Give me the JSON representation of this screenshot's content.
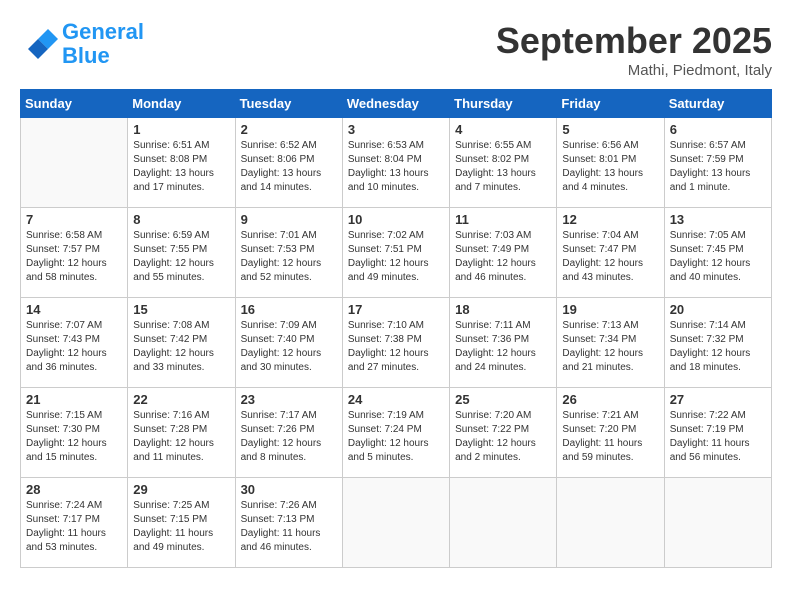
{
  "header": {
    "logo_line1": "General",
    "logo_line2": "Blue",
    "month": "September 2025",
    "location": "Mathi, Piedmont, Italy"
  },
  "weekdays": [
    "Sunday",
    "Monday",
    "Tuesday",
    "Wednesday",
    "Thursday",
    "Friday",
    "Saturday"
  ],
  "weeks": [
    [
      {
        "day": "",
        "info": ""
      },
      {
        "day": "1",
        "info": "Sunrise: 6:51 AM\nSunset: 8:08 PM\nDaylight: 13 hours\nand 17 minutes."
      },
      {
        "day": "2",
        "info": "Sunrise: 6:52 AM\nSunset: 8:06 PM\nDaylight: 13 hours\nand 14 minutes."
      },
      {
        "day": "3",
        "info": "Sunrise: 6:53 AM\nSunset: 8:04 PM\nDaylight: 13 hours\nand 10 minutes."
      },
      {
        "day": "4",
        "info": "Sunrise: 6:55 AM\nSunset: 8:02 PM\nDaylight: 13 hours\nand 7 minutes."
      },
      {
        "day": "5",
        "info": "Sunrise: 6:56 AM\nSunset: 8:01 PM\nDaylight: 13 hours\nand 4 minutes."
      },
      {
        "day": "6",
        "info": "Sunrise: 6:57 AM\nSunset: 7:59 PM\nDaylight: 13 hours\nand 1 minute."
      }
    ],
    [
      {
        "day": "7",
        "info": "Sunrise: 6:58 AM\nSunset: 7:57 PM\nDaylight: 12 hours\nand 58 minutes."
      },
      {
        "day": "8",
        "info": "Sunrise: 6:59 AM\nSunset: 7:55 PM\nDaylight: 12 hours\nand 55 minutes."
      },
      {
        "day": "9",
        "info": "Sunrise: 7:01 AM\nSunset: 7:53 PM\nDaylight: 12 hours\nand 52 minutes."
      },
      {
        "day": "10",
        "info": "Sunrise: 7:02 AM\nSunset: 7:51 PM\nDaylight: 12 hours\nand 49 minutes."
      },
      {
        "day": "11",
        "info": "Sunrise: 7:03 AM\nSunset: 7:49 PM\nDaylight: 12 hours\nand 46 minutes."
      },
      {
        "day": "12",
        "info": "Sunrise: 7:04 AM\nSunset: 7:47 PM\nDaylight: 12 hours\nand 43 minutes."
      },
      {
        "day": "13",
        "info": "Sunrise: 7:05 AM\nSunset: 7:45 PM\nDaylight: 12 hours\nand 40 minutes."
      }
    ],
    [
      {
        "day": "14",
        "info": "Sunrise: 7:07 AM\nSunset: 7:43 PM\nDaylight: 12 hours\nand 36 minutes."
      },
      {
        "day": "15",
        "info": "Sunrise: 7:08 AM\nSunset: 7:42 PM\nDaylight: 12 hours\nand 33 minutes."
      },
      {
        "day": "16",
        "info": "Sunrise: 7:09 AM\nSunset: 7:40 PM\nDaylight: 12 hours\nand 30 minutes."
      },
      {
        "day": "17",
        "info": "Sunrise: 7:10 AM\nSunset: 7:38 PM\nDaylight: 12 hours\nand 27 minutes."
      },
      {
        "day": "18",
        "info": "Sunrise: 7:11 AM\nSunset: 7:36 PM\nDaylight: 12 hours\nand 24 minutes."
      },
      {
        "day": "19",
        "info": "Sunrise: 7:13 AM\nSunset: 7:34 PM\nDaylight: 12 hours\nand 21 minutes."
      },
      {
        "day": "20",
        "info": "Sunrise: 7:14 AM\nSunset: 7:32 PM\nDaylight: 12 hours\nand 18 minutes."
      }
    ],
    [
      {
        "day": "21",
        "info": "Sunrise: 7:15 AM\nSunset: 7:30 PM\nDaylight: 12 hours\nand 15 minutes."
      },
      {
        "day": "22",
        "info": "Sunrise: 7:16 AM\nSunset: 7:28 PM\nDaylight: 12 hours\nand 11 minutes."
      },
      {
        "day": "23",
        "info": "Sunrise: 7:17 AM\nSunset: 7:26 PM\nDaylight: 12 hours\nand 8 minutes."
      },
      {
        "day": "24",
        "info": "Sunrise: 7:19 AM\nSunset: 7:24 PM\nDaylight: 12 hours\nand 5 minutes."
      },
      {
        "day": "25",
        "info": "Sunrise: 7:20 AM\nSunset: 7:22 PM\nDaylight: 12 hours\nand 2 minutes."
      },
      {
        "day": "26",
        "info": "Sunrise: 7:21 AM\nSunset: 7:20 PM\nDaylight: 11 hours\nand 59 minutes."
      },
      {
        "day": "27",
        "info": "Sunrise: 7:22 AM\nSunset: 7:19 PM\nDaylight: 11 hours\nand 56 minutes."
      }
    ],
    [
      {
        "day": "28",
        "info": "Sunrise: 7:24 AM\nSunset: 7:17 PM\nDaylight: 11 hours\nand 53 minutes."
      },
      {
        "day": "29",
        "info": "Sunrise: 7:25 AM\nSunset: 7:15 PM\nDaylight: 11 hours\nand 49 minutes."
      },
      {
        "day": "30",
        "info": "Sunrise: 7:26 AM\nSunset: 7:13 PM\nDaylight: 11 hours\nand 46 minutes."
      },
      {
        "day": "",
        "info": ""
      },
      {
        "day": "",
        "info": ""
      },
      {
        "day": "",
        "info": ""
      },
      {
        "day": "",
        "info": ""
      }
    ]
  ]
}
